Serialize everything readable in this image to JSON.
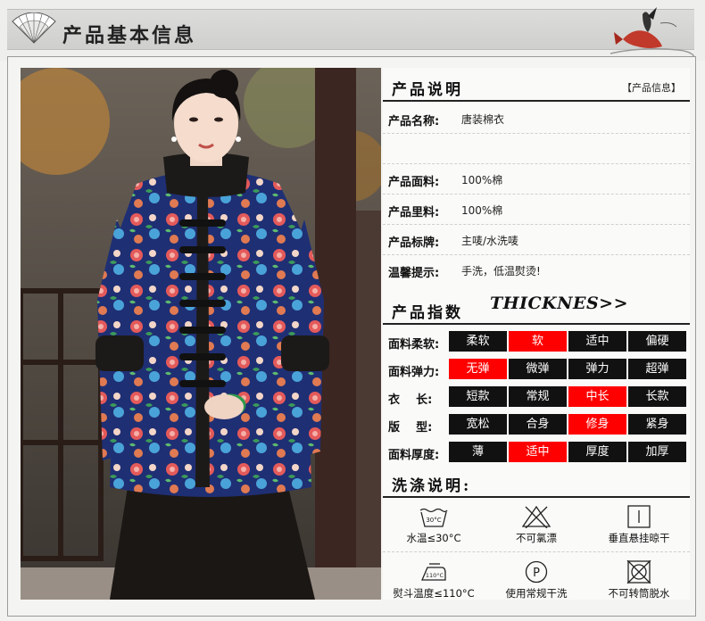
{
  "header": {
    "title": "产品基本信息"
  },
  "product_info": {
    "title": "产品说明",
    "tag": "【产品信息】",
    "rows": [
      {
        "label": "产品名称:",
        "value": "唐装棉衣"
      },
      {
        "label": "",
        "value": ""
      },
      {
        "label": "产品面料:",
        "value": "100%棉"
      },
      {
        "label": "产品里料:",
        "value": "100%棉"
      },
      {
        "label": "产品标牌:",
        "value": "主唛/水洗唛"
      },
      {
        "label": "温馨提示:",
        "value": "手洗，低温熨烫!"
      }
    ]
  },
  "index": {
    "title": "产品指数",
    "subtitle": "THICKNES>>",
    "rows": [
      {
        "label": "面料柔软:",
        "options": [
          "柔软",
          "软",
          "适中",
          "偏硬"
        ],
        "selected": 1
      },
      {
        "label": "面料弹力:",
        "options": [
          "无弹",
          "微弹",
          "弹力",
          "超弹"
        ],
        "selected": 0
      },
      {
        "label": "衣    长:",
        "options": [
          "短款",
          "常规",
          "中长",
          "长款"
        ],
        "selected": 2
      },
      {
        "label": "版    型:",
        "options": [
          "宽松",
          "合身",
          "修身",
          "紧身"
        ],
        "selected": 2
      },
      {
        "label": "面料厚度:",
        "options": [
          "薄",
          "适中",
          "厚度",
          "加厚"
        ],
        "selected": 1
      }
    ]
  },
  "wash": {
    "title": "洗涤说明:",
    "items": [
      {
        "icon": "wash-30c-icon",
        "label": "水温≤30°C",
        "icon_text": "30°C"
      },
      {
        "icon": "no-bleach-icon",
        "label": "不可氯漂",
        "icon_text": ""
      },
      {
        "icon": "hang-dry-icon",
        "label": "垂直悬挂晾干",
        "icon_text": ""
      },
      {
        "icon": "iron-110c-icon",
        "label": "熨斗温度≤110°C",
        "icon_text": "110°C"
      },
      {
        "icon": "professional-dryclean-icon",
        "label": "使用常规干洗",
        "icon_text": "P"
      },
      {
        "icon": "no-tumble-dry-icon",
        "label": "不可转筒脱水",
        "icon_text": ""
      }
    ]
  },
  "colors": {
    "selected": "#ff0000",
    "cell": "#111111",
    "accent_fish": "#c0392b"
  }
}
